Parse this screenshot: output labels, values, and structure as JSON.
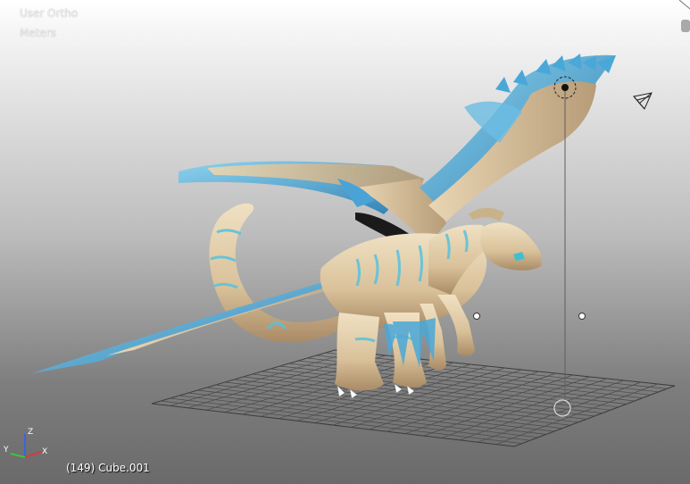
{
  "viewport": {
    "view_name": "User Ortho",
    "units": "Meters",
    "object_label": "(149) Cube.001"
  },
  "axis_gizmo": {
    "x": "X",
    "y": "Y",
    "z": "Z"
  },
  "colors": {
    "body": "#e4cfaa",
    "body_shadow": "#b89a73",
    "stripes": "#55c2e0",
    "feathers": "#5ab3da",
    "grid": "#4a4a4a",
    "axis_x": "#d83a3a",
    "axis_y": "#3bc43b",
    "axis_z": "#3a64e0"
  }
}
